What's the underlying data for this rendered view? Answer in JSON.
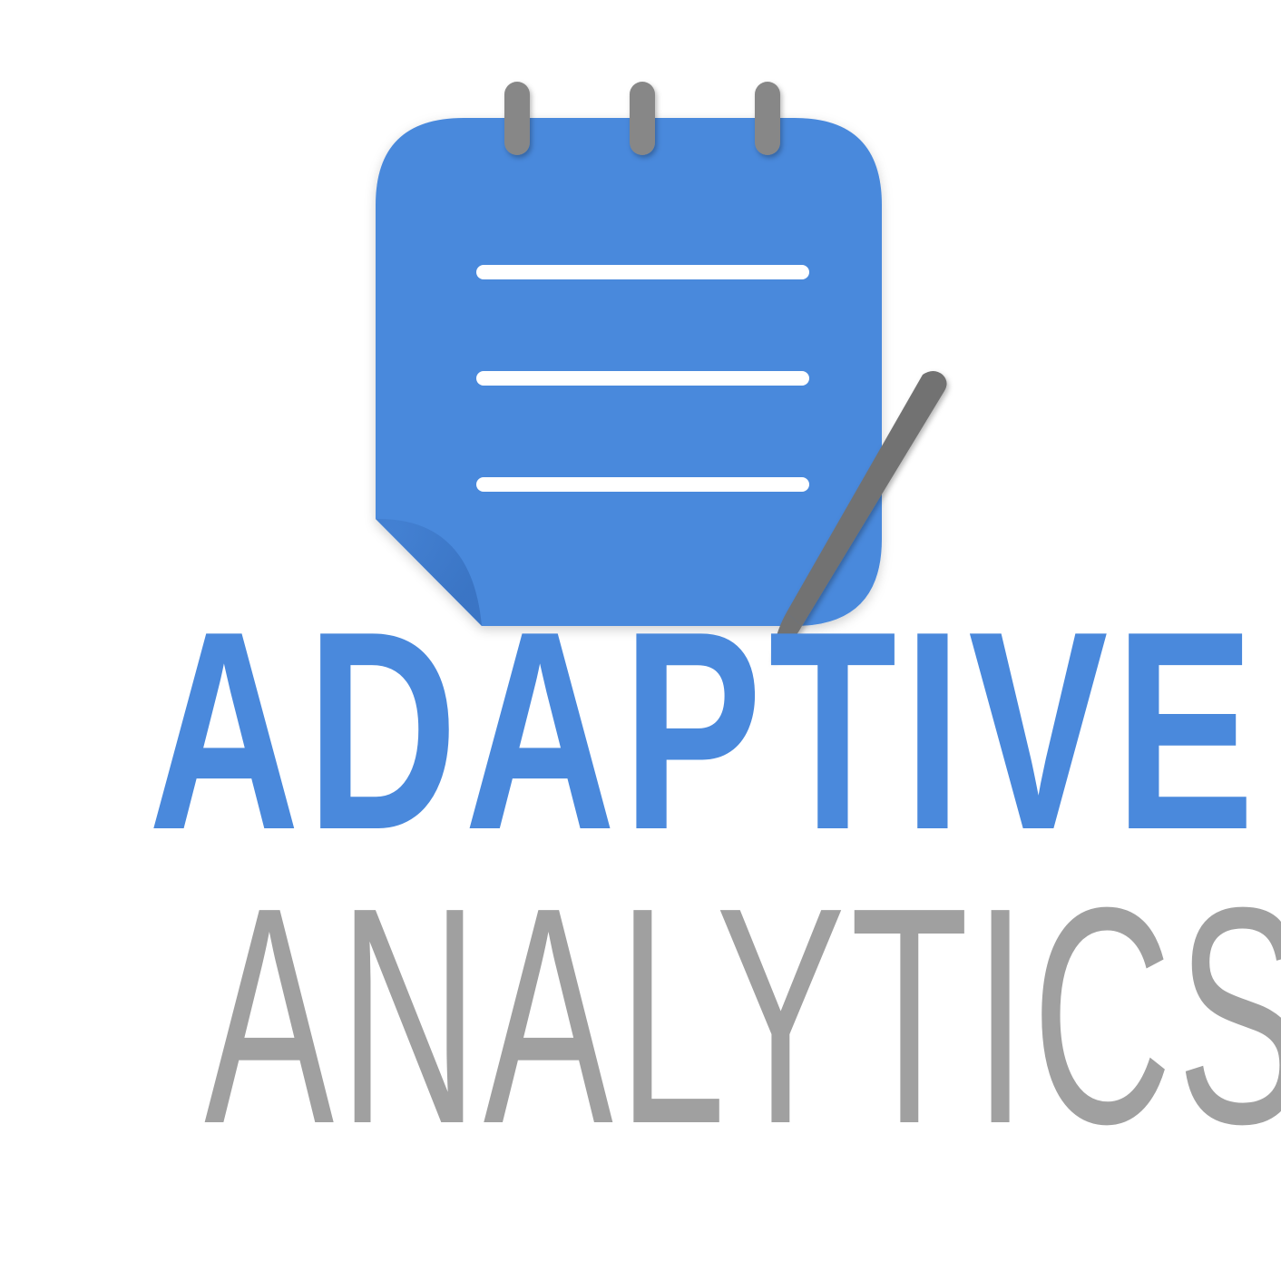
{
  "logo": {
    "primary_word": "ADAPTIVE",
    "secondary_word": "ANALYTICS",
    "icon": "notepad-with-pen-icon",
    "colors": {
      "background": "#ffffff",
      "accent_blue": "#4a89dc",
      "pen_gray": "#727272",
      "ring_gray": "#878787",
      "text_gray": "#a0a0a0",
      "line_white": "#ffffff"
    }
  }
}
